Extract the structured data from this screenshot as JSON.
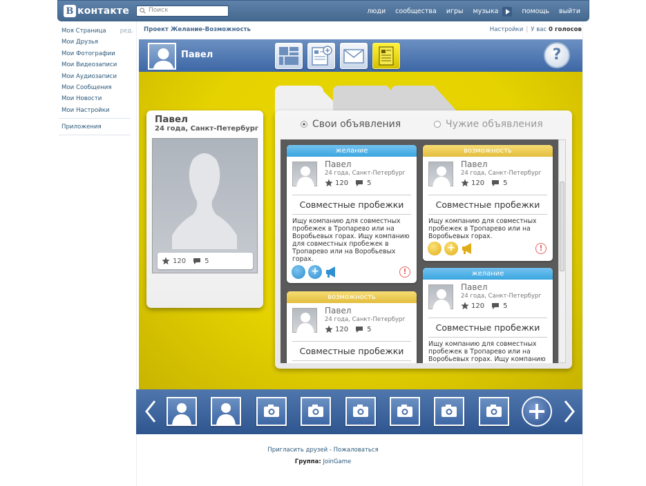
{
  "header": {
    "logo_text": "контакте",
    "logo_letter": "В",
    "search_placeholder": "Поиск",
    "nav": [
      "люди",
      "сообщества",
      "игры",
      "музыка",
      "помощь",
      "выйти"
    ]
  },
  "leftmenu": {
    "items": [
      "Моя Страница",
      "Мои Друзья",
      "Мои Фотографии",
      "Мои Видеозаписи",
      "Мои Аудиозаписи",
      "Мои Сообщения",
      "Мои Новости",
      "Мои Настройки"
    ],
    "edit": "ред.",
    "apps": "Приложения"
  },
  "app": {
    "title": "Проект Желание-Возможность",
    "settings": "Настройки",
    "votes_label": "У вас",
    "votes_value": "0 голосов",
    "user_name": "Павел"
  },
  "profile": {
    "name": "Павел",
    "info": "24 года, Санкт-Петербург",
    "rating": "120",
    "comments": "5"
  },
  "tabs": {
    "own": "Свои объявления",
    "others": "Чужие объявления"
  },
  "cards": [
    {
      "type": "желание",
      "name": "Павел",
      "info": "24 года, Санкт-Петербург",
      "rating": "120",
      "comments": "5",
      "title": "Совместные пробежки",
      "text": "Ищу компанию для совместных пробежек в Тропарево или на Воробьевых горах. Ищу компанию для совместных пробежек в Тропарево или на Воробьевых горах."
    },
    {
      "type": "возможность",
      "name": "Павел",
      "info": "24 года, Санкт-Петербург",
      "rating": "120",
      "comments": "5",
      "title": "Совместные пробежки",
      "text": "Ищу компанию для совместных пробежек в Тропарево или на Воробьевых горах."
    },
    {
      "type": "возможность",
      "name": "Павел",
      "info": "24 года, Санкт-Петербург",
      "rating": "120",
      "comments": "5",
      "title": "Совместные пробежки",
      "text": ""
    },
    {
      "type": "желание",
      "name": "Павел",
      "info": "24 года, Санкт-Петербург",
      "rating": "120",
      "comments": "5",
      "title": "Совместные пробежки",
      "text": "Ищу компанию для совместных пробежек в Тропарево или на Воробьевых горах. Ищу компанию"
    }
  ],
  "footer": {
    "invite": "Пригласить друзей",
    "dash": " - ",
    "complain": "Пожаловаться",
    "group_label": "Группа:",
    "group_name": "JoinGame"
  },
  "colors": {
    "vk_blue": "#45688e",
    "yellow": "#e5d200",
    "desire": "#3ba6e0",
    "possibility": "#e2bd3d"
  }
}
